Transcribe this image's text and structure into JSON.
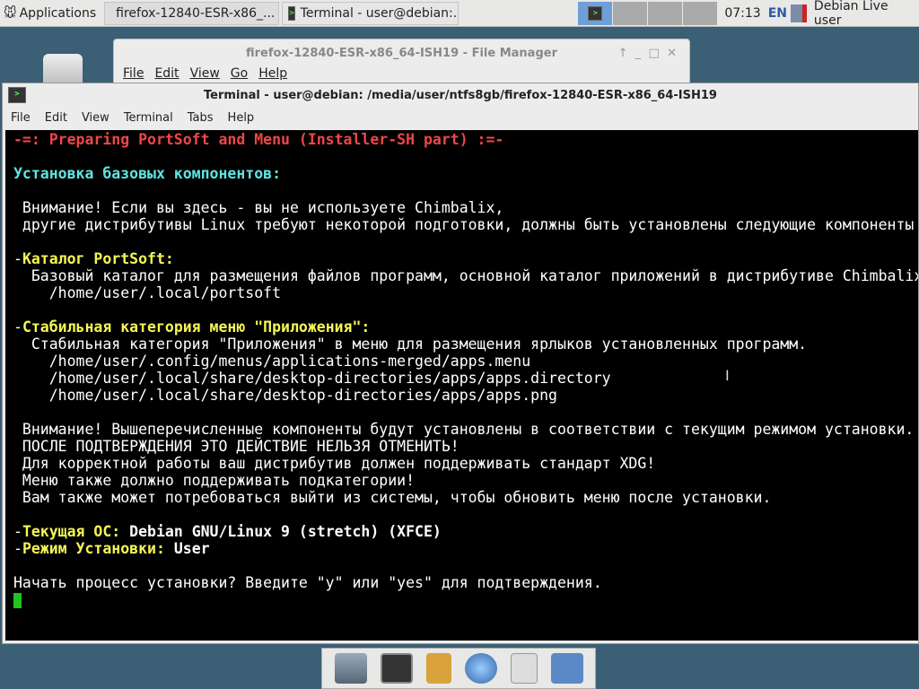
{
  "panel": {
    "applications": "Applications",
    "tasks": [
      "firefox-12840-ESR-x86_...",
      "Terminal - user@debian:..."
    ],
    "clock": "07:13",
    "keyboard": "EN",
    "user": "Debian Live user"
  },
  "file_manager": {
    "title": "firefox-12840-ESR-x86_64-ISH19 - File Manager",
    "menu": [
      "File",
      "Edit",
      "View",
      "Go",
      "Help"
    ]
  },
  "terminal": {
    "title": "Terminal - user@debian: /media/user/ntfs8gb/firefox-12840-ESR-x86_64-ISH19",
    "menu": [
      "File",
      "Edit",
      "View",
      "Terminal",
      "Tabs",
      "Help"
    ],
    "lines": {
      "l0": "-=: Preparing PortSoft and Menu (Installer-SH part) :=-",
      "l2": "Установка базовых компонентов:",
      "l4": " Внимание! Если вы здесь - вы не используете Chimbalix,",
      "l5": " другие дистрибутивы Linux требуют некоторой подготовки, должны быть установлены следующие компоненты",
      "l7a": "-",
      "l7b": "Каталог PortSoft:",
      "l8": "  Базовый каталог для размещения файлов программ, основной каталог приложений в дистрибутиве Chimbalix",
      "l9": "    /home/user/.local/portsoft",
      "l11a": "-",
      "l11b": "Стабильная категория меню \"Приложения\":",
      "l12": "  Стабильная категория \"Приложения\" в меню для размещения ярлыков установленных программ.",
      "l13": "    /home/user/.config/menus/applications-merged/apps.menu",
      "l14": "    /home/user/.local/share/desktop-directories/apps/apps.directory",
      "l15": "    /home/user/.local/share/desktop-directories/apps/apps.png",
      "l17": " Внимание! Вышеперечисленные компоненты будут установлены в соответствии с текущим режимом установки.",
      "l18": " ПОСЛЕ ПОДТВЕРЖДЕНИЯ ЭТО ДЕЙСТВИЕ НЕЛЬЗЯ ОТМЕНИТЬ!",
      "l19": " Для корректной работы ваш дистрибутив должен поддерживать стандарт XDG!",
      "l20": " Меню также должно поддерживать подкатегории!",
      "l21": " Вам также может потребоваться выйти из системы, чтобы обновить меню после установки.",
      "l23a": "-",
      "l23b": "Текущая ОС:",
      "l23c": " Debian GNU/Linux 9 (stretch) (XFCE)",
      "l24a": "-",
      "l24b": "Режим Установки:",
      "l24c": " User",
      "l26": "Начать процесс установки? Введите \"y\" или \"yes\" для подтверждения."
    }
  }
}
